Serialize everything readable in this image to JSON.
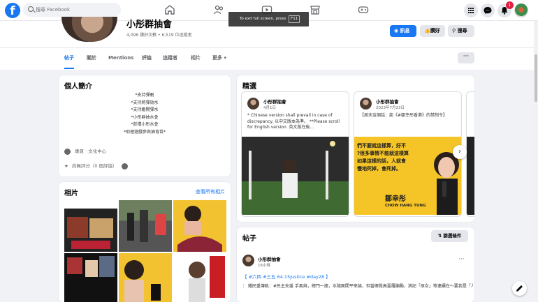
{
  "search": {
    "placeholder": "搜尋 Facebook"
  },
  "fullscreen_tip": {
    "text": "To exit full screen, press",
    "key": "F11"
  },
  "notifications": {
    "count": "1"
  },
  "profile": {
    "name": "小彤群抽會",
    "stats": "4,096 讚好次數 • 6,519 位追蹤者",
    "buttons": {
      "message": "訊息",
      "like": "讚好",
      "search": "搜尋"
    }
  },
  "tabs": [
    "帖子",
    "關於",
    "Mentions",
    "評論",
    "追蹤者",
    "相片",
    "更多"
  ],
  "intro": {
    "title": "個人簡介",
    "lines": [
      "*支持彈刪",
      "*支持將彈劾水",
      "*支持繼開彈水",
      "*小彤群抽水會",
      "*彭禮小彤水會",
      "*助理遊戲參與抽育苗*"
    ],
    "category": "專頁 · 文化中心",
    "rating": "尚無評分（0 個評論）"
  },
  "photos": {
    "title": "相片",
    "see_all": "查看所有相片"
  },
  "featured": {
    "title": "精選",
    "cards": [
      {
        "name": "小彤群抽會",
        "date": "4月1日",
        "text": "* Chinese version shall prevail in case of discrepancy. 以中文版本為準。 **Please scroll for English version. 英文版在後..."
      },
      {
        "name": "小彤群抽會",
        "date": "2023年7月23日",
        "text": "【周末這個話：談《#鄒幸彤香港》的禁制令】",
        "img_line1": "們不要就這樣算，好不",
        "img_line2": "?很多事情不能就這樣算",
        "img_line3": "如果這樣的話，人就會",
        "img_line4": "慢地死掉，會死掉。",
        "img_name": "鄒幸彤",
        "img_name_en": "CHOW HANG TUNG"
      }
    ]
  },
  "posts": {
    "title": "帖子",
    "filter": "篩選條件",
    "first": {
      "name": "小彤群抽會",
      "time": "16小時",
      "tags": "【 #六四 #三五 64.15justice #day28 】",
      "body": "： 鐵民重傳軌：#民主支援 手風與，總門一據，水隨面間平來論，但當鄉覺高臺羅顯勵，滴記「原女」等連續在～要我是「人不要」！"
    }
  },
  "colors": {
    "brand": "#1877f2",
    "background": "#f0f2f5"
  }
}
